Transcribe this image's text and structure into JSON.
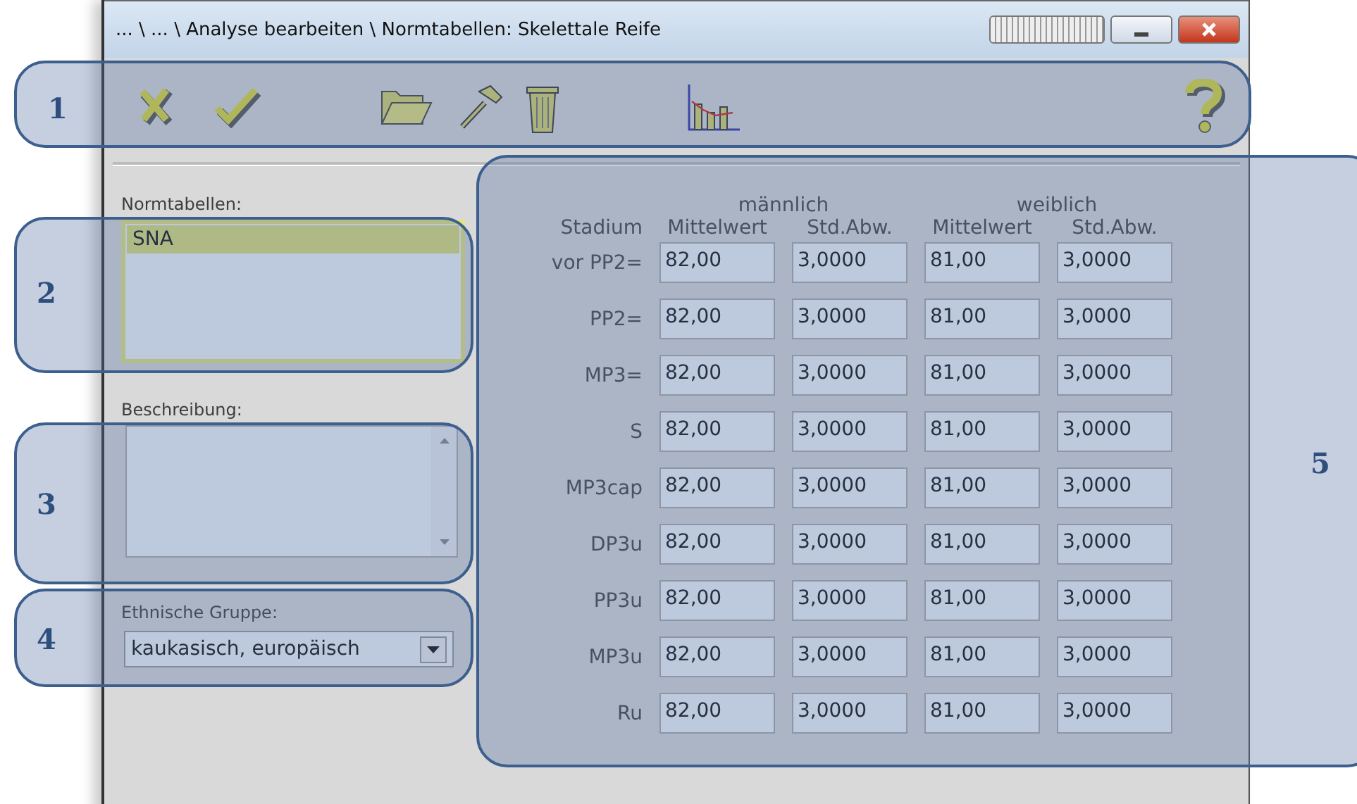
{
  "window": {
    "title": "... \\ ... \\ Analyse bearbeiten \\ Normtabellen: Skelettale Reife"
  },
  "normtabellen": {
    "label": "Normtabellen:",
    "items": [
      {
        "label": "SNA",
        "selected": true
      }
    ]
  },
  "beschreibung": {
    "label": "Beschreibung:"
  },
  "ethnische_gruppe": {
    "label": "Ethnische Gruppe:",
    "value": "kaukasisch, europäisch"
  },
  "table": {
    "groups": [
      "männlich",
      "weiblich"
    ],
    "columns": [
      "Stadium",
      "Mittelwert",
      "Std.Abw.",
      "Mittelwert",
      "Std.Abw."
    ],
    "rows": [
      {
        "stage": "vor PP2=",
        "values": [
          "82,00",
          "3,0000",
          "81,00",
          "3,0000"
        ]
      },
      {
        "stage": "PP2=",
        "values": [
          "82,00",
          "3,0000",
          "81,00",
          "3,0000"
        ]
      },
      {
        "stage": "MP3=",
        "values": [
          "82,00",
          "3,0000",
          "81,00",
          "3,0000"
        ]
      },
      {
        "stage": "S",
        "values": [
          "82,00",
          "3,0000",
          "81,00",
          "3,0000"
        ]
      },
      {
        "stage": "MP3cap",
        "values": [
          "82,00",
          "3,0000",
          "81,00",
          "3,0000"
        ]
      },
      {
        "stage": "DP3u",
        "values": [
          "82,00",
          "3,0000",
          "81,00",
          "3,0000"
        ]
      },
      {
        "stage": "PP3u",
        "values": [
          "82,00",
          "3,0000",
          "81,00",
          "3,0000"
        ]
      },
      {
        "stage": "MP3u",
        "values": [
          "82,00",
          "3,0000",
          "81,00",
          "3,0000"
        ]
      },
      {
        "stage": "Ru",
        "values": [
          "82,00",
          "3,0000",
          "81,00",
          "3,0000"
        ]
      }
    ]
  },
  "callouts": [
    {
      "number": "1"
    },
    {
      "number": "2"
    },
    {
      "number": "3"
    },
    {
      "number": "4"
    },
    {
      "number": "5"
    }
  ]
}
